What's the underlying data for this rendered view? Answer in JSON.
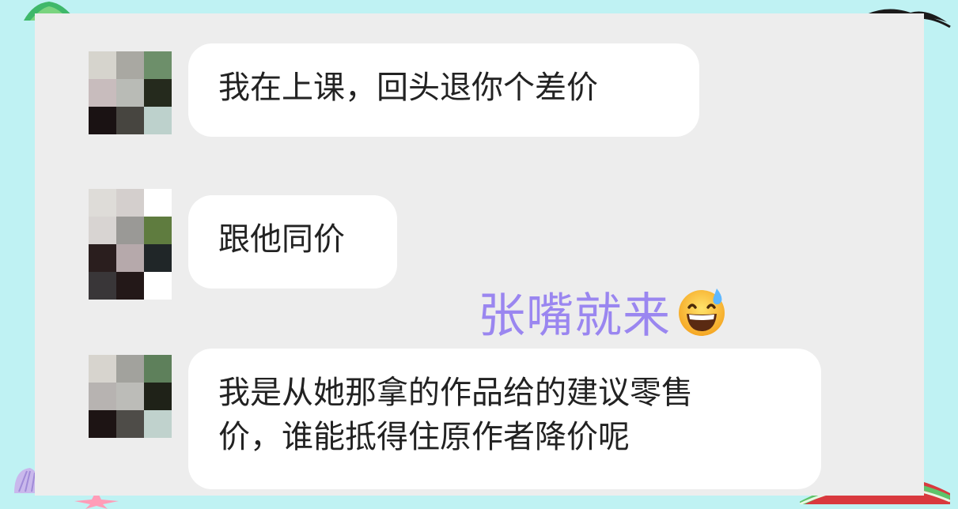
{
  "messages": [
    {
      "text": "我在上课，回头退你个差价",
      "avatar_colors": [
        "#d6d4cd",
        "#a9a8a2",
        "#6d8f6a",
        "#c8bcbd",
        "#b9bbb6",
        "#252a1d",
        "#1a1213",
        "#474540",
        "#bdd1cc"
      ]
    },
    {
      "text": "跟他同价",
      "avatar_colors": [
        "#dedcd8",
        "#d4cfcd",
        "#ffffff",
        "#d8d4d2",
        "#9a9996",
        "#5f7c3f",
        "#2a1e1e",
        "#b6a9ab",
        "#202628",
        "#393638",
        "#231818",
        "#ffffff"
      ]
    },
    {
      "text_lines": [
        "我是从她那拿的作品给的建议零售",
        "价，谁能抵得住原作者降价呢"
      ],
      "avatar_colors": [
        "#d7d4ce",
        "#a2a29d",
        "#5e805b",
        "#b7b3b1",
        "#bcbcb8",
        "#1f2218",
        "#1d1414",
        "#4e4c48",
        "#c0d2cd"
      ]
    }
  ],
  "overlay": {
    "caption": "张嘴就来",
    "caption_color": "#9a86f0",
    "emoji": "grinning-face-with-sweat"
  },
  "colors": {
    "background": "#bff2f3",
    "panel": "#ededed",
    "bubble": "#ffffff",
    "text": "#222222"
  }
}
